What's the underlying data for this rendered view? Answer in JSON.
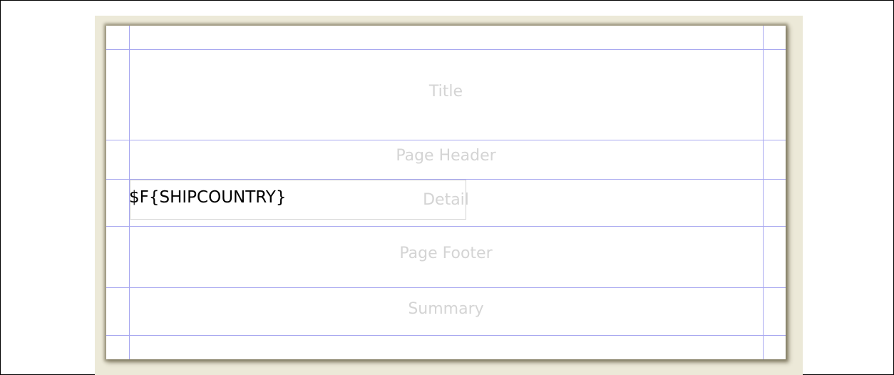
{
  "report_designer": {
    "bands": {
      "title": "Title",
      "page_header": "Page Header",
      "detail": "Detail",
      "page_footer": "Page Footer",
      "summary": "Summary"
    },
    "fields": [
      {
        "expression": "$F{SHIPCOUNTRY}"
      }
    ]
  },
  "colors": {
    "canvas_background": "#ece9d8",
    "guide_line": "#a8a8f0",
    "band_label": "#d4d4d4",
    "field_text": "#000000",
    "field_border": "#d2d2d2"
  }
}
